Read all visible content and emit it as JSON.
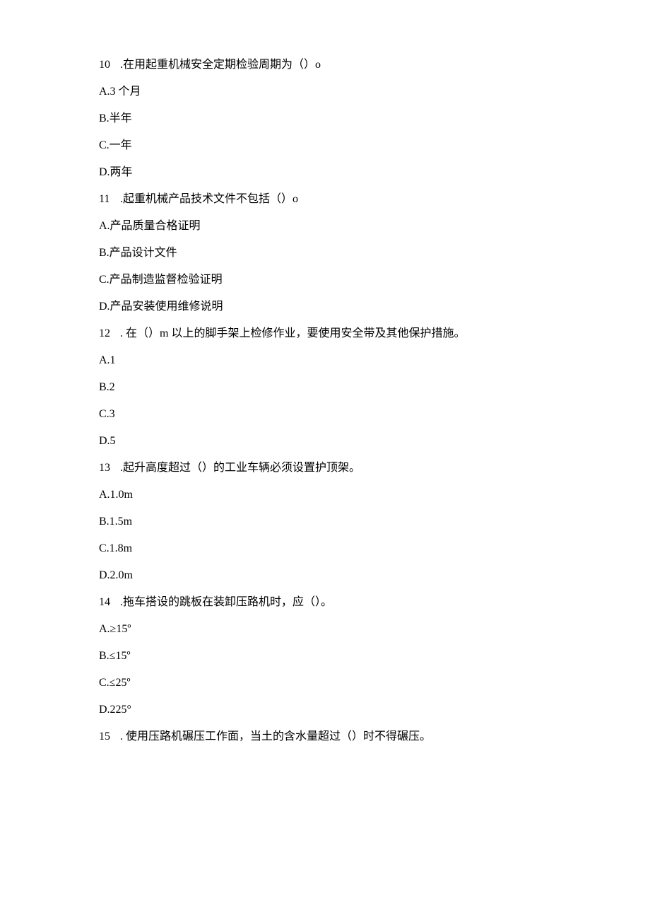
{
  "questions": [
    {
      "number": "10",
      "text": ".在用起重机械安全定期检验周期为（）o",
      "options": [
        {
          "label": "A.3 个月"
        },
        {
          "label": "B.半年"
        },
        {
          "label": "C.一年"
        },
        {
          "label": "D.两年"
        }
      ]
    },
    {
      "number": "11",
      "text": ".起重机械产品技术文件不包括（）o",
      "options": [
        {
          "label": "A.产品质量合格证明"
        },
        {
          "label": "B.产品设计文件"
        },
        {
          "label": "C.产品制造监督检验证明"
        },
        {
          "label": "D.产品安装使用维修说明"
        }
      ]
    },
    {
      "number": "12",
      "text": ". 在（）m 以上的脚手架上检修作业，要使用安全带及其他保护措施。",
      "options": [
        {
          "label": "A.1"
        },
        {
          "label": "B.2"
        },
        {
          "label": "C.3"
        },
        {
          "label": "D.5"
        }
      ]
    },
    {
      "number": "13",
      "text": ".起升高度超过（）的工业车辆必须设置护顶架。",
      "options": [
        {
          "label": "A.1.0m"
        },
        {
          "label": "B.1.5m"
        },
        {
          "label": "C.1.8m"
        },
        {
          "label": "D.2.0m"
        }
      ]
    },
    {
      "number": "14",
      "text": ".拖车搭设的跳板在装卸压路机时，应（）。",
      "options": [
        {
          "label": "A.≥15º"
        },
        {
          "label": "B.≤15º"
        },
        {
          "label": "C.≤25º"
        },
        {
          "label": "D.225°"
        }
      ]
    },
    {
      "number": "15",
      "text": ". 使用压路机碾压工作面，当土的含水量超过（）时不得碾压。",
      "options": []
    }
  ]
}
